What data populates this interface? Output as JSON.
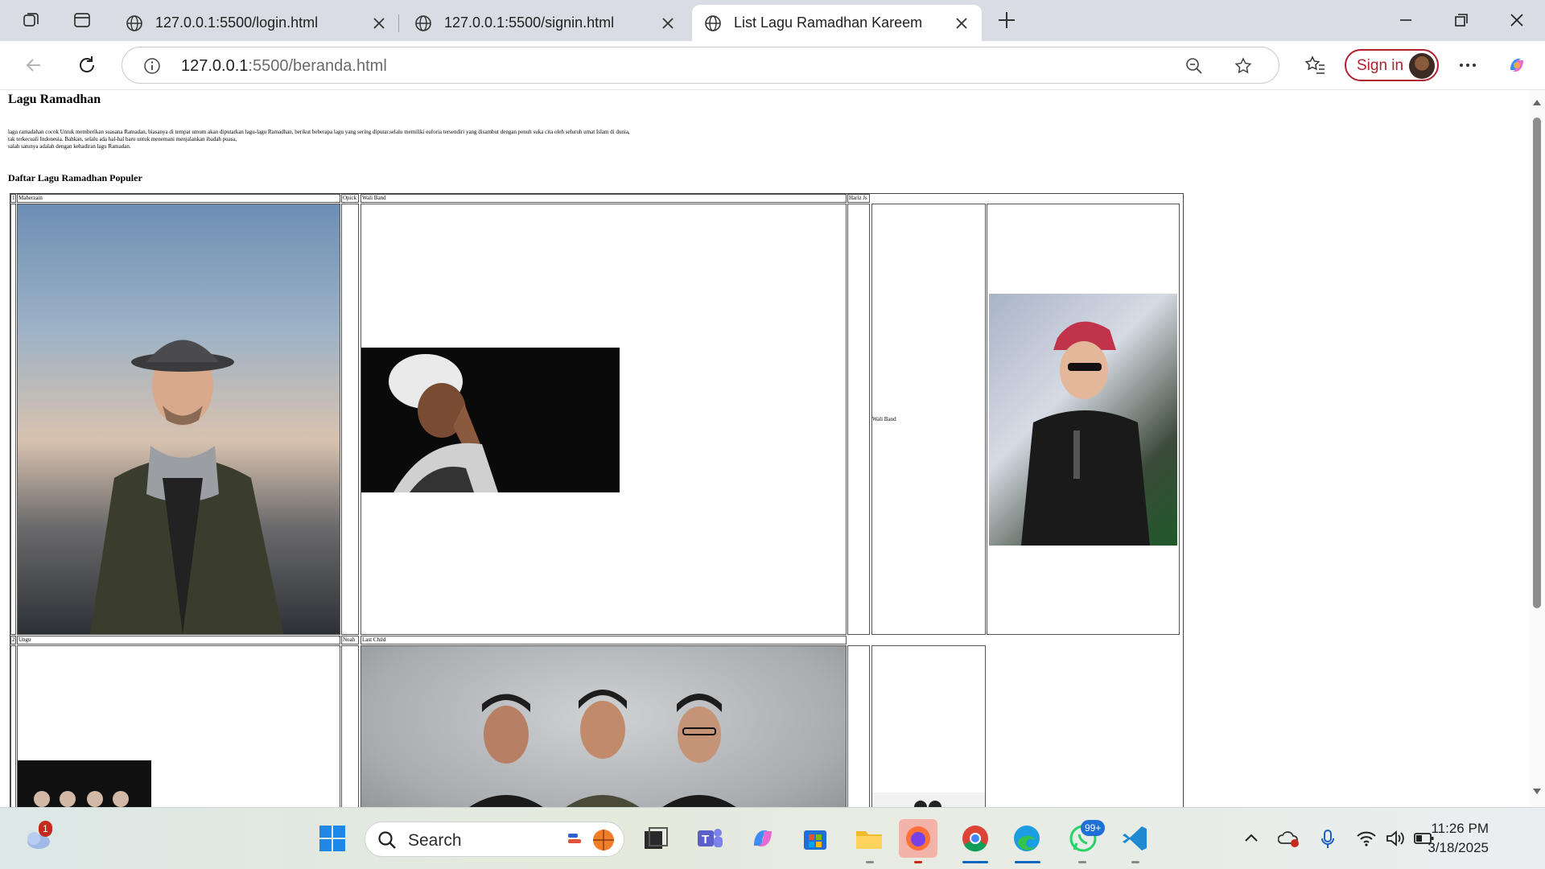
{
  "browser": {
    "tabs": [
      {
        "title": "127.0.0.1:5500/login.html",
        "active": false
      },
      {
        "title": "127.0.0.1:5500/signin.html",
        "active": false
      },
      {
        "title": "List Lagu Ramadhan Kareem",
        "active": true
      }
    ],
    "url_host": "127.0.0.1",
    "url_rest": ":5500/beranda.html",
    "signin_label": "Sign in"
  },
  "page": {
    "heading": "Lagu Ramadhan",
    "intro_line1": "lagu ramadahan cocok Untuk memberikan suasana Ramadan, biasanya di tempat umum akan diputarkan lagu-lagu Ramadhan, berikut beberapa lagu yang sering diputar.selalu memiliki euforia tersendiri yang disambut dengan penuh suka cita oleh seluruh umat Islam di dunia,",
    "intro_line2": "tak terkecuali Indonesia. Bahkan, selalu ada hal-hal baru untuk menemani menjalankan ibadah puasa,",
    "intro_line3": "salah satunya adalah dengan kehadiran lagu Ramadan.",
    "subheading": "Daftar Lagu Ramadhan Populer",
    "rows": [
      {
        "no": "1",
        "artists": [
          "Maherzain",
          "Opick",
          "Wali Band",
          "Hariz Js"
        ],
        "broken_alt": "Wali Band"
      },
      {
        "no": "2",
        "artists": [
          "Ungu",
          "Noah",
          "Last Child"
        ]
      }
    ]
  },
  "taskbar": {
    "search_placeholder": "Search",
    "time": "11:26 PM",
    "date": "3/18/2025",
    "weather_badge": "1",
    "whatsapp_badge": "99+"
  },
  "colors": {
    "signin_accent": "#b1202e",
    "taskbar_active": "#0067c0"
  }
}
